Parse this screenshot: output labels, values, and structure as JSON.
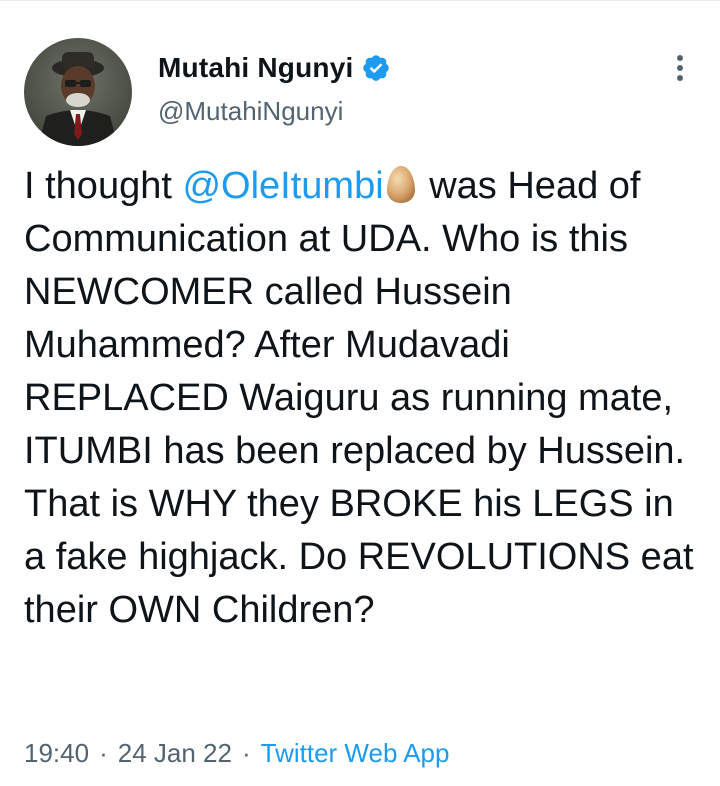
{
  "author": {
    "name": "Mutahi Ngunyi",
    "handle": "@MutahiNgunyi",
    "verified": true,
    "avatar": "profile-photo"
  },
  "tweet": {
    "line1_pre": "I thought ",
    "mention": "@OleItumbi",
    "emoji": "egg-emoji",
    "line1_post": " was Head of Communication at UDA. Who is this NEWCOMER called Hussein Muhammed? After Mudavadi REPLACED Waiguru as running mate, ITUMBI has been replaced by Hussein. That is WHY they BROKE his LEGS in a fake highjack. Do REVOLUTIONS eat their OWN Children?"
  },
  "meta": {
    "time": "19:40",
    "separator": "·",
    "date": "24 Jan 22",
    "source": "Twitter Web App"
  },
  "icons": {
    "verified": "verified-badge-icon",
    "more": "more-vertical-icon"
  },
  "colors": {
    "accent": "#1d9bf0",
    "text": "#0f1419",
    "secondary": "#536471"
  }
}
